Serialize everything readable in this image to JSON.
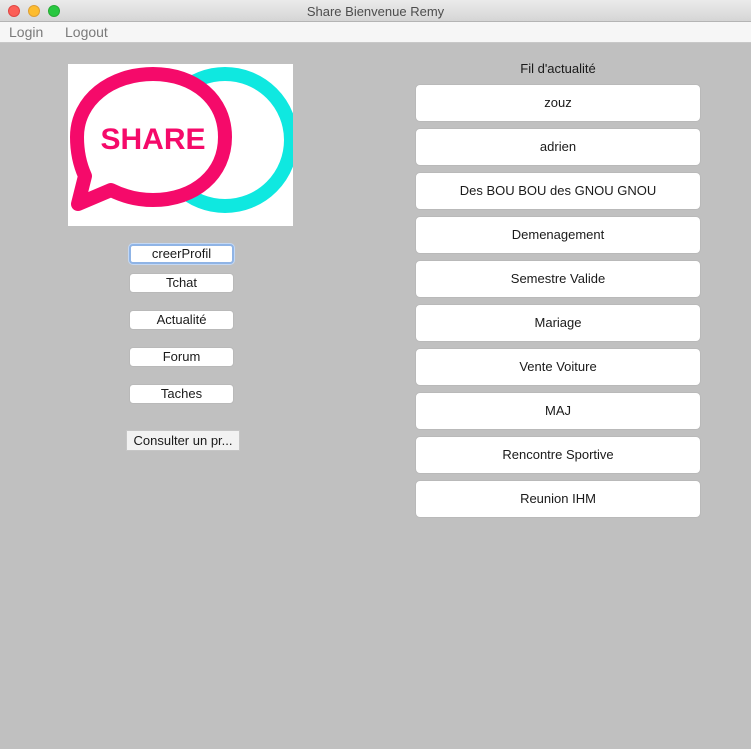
{
  "window": {
    "title": "Share Bienvenue Remy"
  },
  "menubar": {
    "login": "Login",
    "logout": "Logout"
  },
  "logo": {
    "text": "SHARE",
    "bubble_color": "#f50a6a",
    "ring_color": "#0fe8e0"
  },
  "left_buttons": {
    "creer_profil": "creerProfil",
    "tchat": "Tchat",
    "actualite": "Actualité",
    "forum": "Forum",
    "taches": "Taches",
    "consulter": "Consulter un pr..."
  },
  "feed": {
    "title": "Fil d'actualité",
    "items": [
      "zouz",
      "adrien",
      "Des BOU BOU des GNOU GNOU",
      "Demenagement",
      "Semestre Valide",
      "Mariage",
      "Vente Voiture",
      "MAJ",
      "Rencontre Sportive",
      "Reunion IHM"
    ]
  }
}
